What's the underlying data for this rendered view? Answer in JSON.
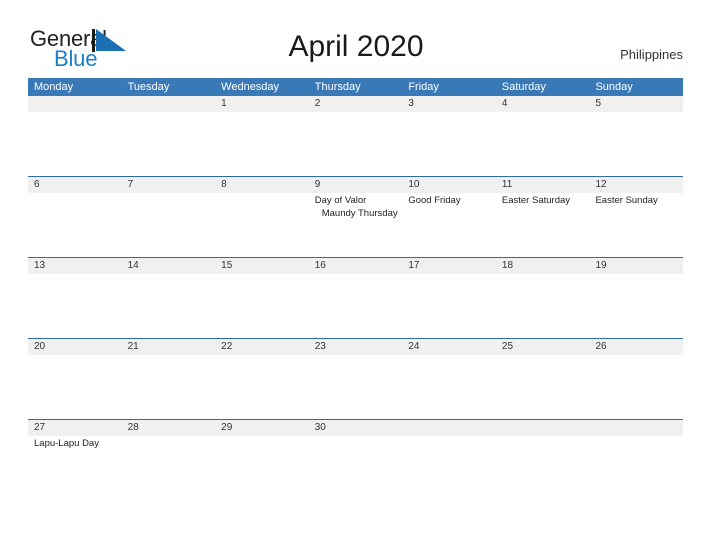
{
  "brand": {
    "name_part1": "General",
    "name_part2": "Blue",
    "flag_icon": "blue-flag-triangle-icon",
    "accent_color": "#1a7fc6"
  },
  "header": {
    "title": "April 2020",
    "country": "Philippines"
  },
  "theme": {
    "header_blue": "#3a79b8",
    "row_border_blue": "#2e6da4",
    "date_band_gray": "#f0f0f0",
    "text_dark": "#333333"
  },
  "calendar": {
    "weekdays": [
      "Monday",
      "Tuesday",
      "Wednesday",
      "Thursday",
      "Friday",
      "Saturday",
      "Sunday"
    ],
    "weeks": [
      {
        "days": [
          {
            "date": "",
            "events": []
          },
          {
            "date": "",
            "events": []
          },
          {
            "date": "1",
            "events": []
          },
          {
            "date": "2",
            "events": []
          },
          {
            "date": "3",
            "events": []
          },
          {
            "date": "4",
            "events": []
          },
          {
            "date": "5",
            "events": []
          }
        ]
      },
      {
        "days": [
          {
            "date": "6",
            "events": []
          },
          {
            "date": "7",
            "events": []
          },
          {
            "date": "8",
            "events": []
          },
          {
            "date": "9",
            "events": [
              {
                "label": "Day of Valor",
                "indented": false
              },
              {
                "label": "Maundy Thursday",
                "indented": true
              }
            ]
          },
          {
            "date": "10",
            "events": [
              {
                "label": "Good Friday",
                "indented": false
              }
            ]
          },
          {
            "date": "11",
            "events": [
              {
                "label": "Easter Saturday",
                "indented": false
              }
            ]
          },
          {
            "date": "12",
            "events": [
              {
                "label": "Easter Sunday",
                "indented": false
              }
            ]
          }
        ]
      },
      {
        "days": [
          {
            "date": "13",
            "events": []
          },
          {
            "date": "14",
            "events": []
          },
          {
            "date": "15",
            "events": []
          },
          {
            "date": "16",
            "events": []
          },
          {
            "date": "17",
            "events": []
          },
          {
            "date": "18",
            "events": []
          },
          {
            "date": "19",
            "events": []
          }
        ]
      },
      {
        "days": [
          {
            "date": "20",
            "events": []
          },
          {
            "date": "21",
            "events": []
          },
          {
            "date": "22",
            "events": []
          },
          {
            "date": "23",
            "events": []
          },
          {
            "date": "24",
            "events": []
          },
          {
            "date": "25",
            "events": []
          },
          {
            "date": "26",
            "events": []
          }
        ]
      },
      {
        "days": [
          {
            "date": "27",
            "events": [
              {
                "label": "Lapu-Lapu Day",
                "indented": false
              }
            ]
          },
          {
            "date": "28",
            "events": []
          },
          {
            "date": "29",
            "events": []
          },
          {
            "date": "30",
            "events": []
          },
          {
            "date": "",
            "events": []
          },
          {
            "date": "",
            "events": []
          },
          {
            "date": "",
            "events": []
          }
        ]
      }
    ]
  }
}
